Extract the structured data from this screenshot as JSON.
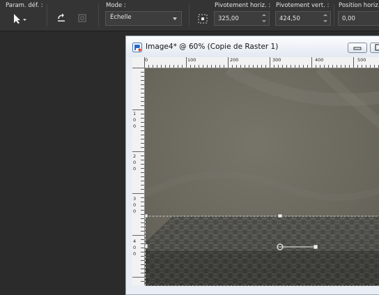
{
  "toolbar": {
    "presets_label": "Param. déf. :",
    "mode_label": "Mode :",
    "mode_value": "Échelle",
    "pivot_h_label": "Pivotement horiz. :",
    "pivot_h_value": "325,00",
    "pivot_v_label": "Pivotement vert. :",
    "pivot_v_value": "424,50",
    "pos_h_label": "Position horiz. :",
    "pos_h_value": "0,00"
  },
  "window": {
    "title": "Image4* @  60% (Copie de Raster 1)",
    "h_ruler_labels": [
      "0",
      "100",
      "200",
      "300",
      "400",
      "500"
    ],
    "v_ruler_labels": [
      [
        "1",
        "0",
        "0"
      ],
      [
        "2",
        "0",
        "0"
      ],
      [
        "3",
        "0",
        "0"
      ],
      [
        "4",
        "0",
        "0"
      ]
    ]
  },
  "colors": {
    "toolbar_bg": "#343434",
    "workspace_bg": "#2b2b2b",
    "canvas_fill": "#6d6a60",
    "floor_fill": "#4a4a46"
  }
}
